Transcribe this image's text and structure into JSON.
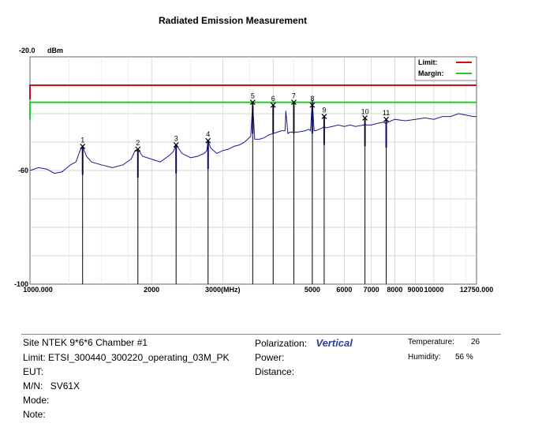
{
  "chart_data": {
    "type": "line",
    "title": "Radiated Emission Measurement",
    "ylabel": "dBm",
    "y_top_label": "-20.0",
    "y_ticks": [
      -60,
      -100
    ],
    "ylim": [
      -100,
      -20
    ],
    "x_ticks": [
      {
        "value": 1000,
        "label": "1000.000"
      },
      {
        "value": 2000,
        "label": "2000"
      },
      {
        "value": 3000,
        "label": "3000(MHz)"
      },
      {
        "value": 5000,
        "label": "5000"
      },
      {
        "value": 6000,
        "label": "6000"
      },
      {
        "value": 7000,
        "label": "7000"
      },
      {
        "value": 8000,
        "label": "8000"
      },
      {
        "value": 9000,
        "label": "9000"
      },
      {
        "value": 10000,
        "label": "10000"
      },
      {
        "value": 12750,
        "label": "12750.000"
      }
    ],
    "xlim": [
      1000,
      12750
    ],
    "x_scale": "log",
    "limit": {
      "label": "Limit:",
      "value": -30,
      "color": "#cc1111"
    },
    "margin": {
      "label": "Margin:",
      "value": -36,
      "color": "#22cc22"
    },
    "trace_color": "#1a1a8c",
    "trace": {
      "x": [
        1000,
        1050,
        1100,
        1150,
        1200,
        1260,
        1300,
        1330,
        1350,
        1380,
        1420,
        1500,
        1600,
        1700,
        1780,
        1820,
        1850,
        1900,
        2000,
        2100,
        2200,
        2260,
        2300,
        2380,
        2500,
        2600,
        2700,
        2740,
        2760,
        2800,
        2900,
        3000,
        3100,
        3150,
        3200,
        3300,
        3400,
        3520,
        3560,
        3600,
        3700,
        3800,
        3900,
        4000,
        4100,
        4200,
        4280,
        4300,
        4350,
        4400,
        4600,
        4800,
        4900,
        4950,
        5000,
        5050,
        5100,
        5200,
        5300,
        5350,
        5400,
        5600,
        5800,
        6000,
        6200,
        6400,
        6700,
        6750,
        6800,
        7000,
        7200,
        7500,
        7620,
        7700,
        8000,
        8500,
        9000,
        9500,
        10000,
        10500,
        11000,
        11500,
        12000,
        12500,
        12750
      ],
      "y": [
        -60,
        -59,
        -59.5,
        -61,
        -60.5,
        -58,
        -57,
        -53,
        -51.5,
        -55,
        -57,
        -58,
        -59,
        -58,
        -56,
        -53,
        -52.5,
        -55,
        -56,
        -57,
        -55,
        -53.5,
        -51,
        -54,
        -55.5,
        -55,
        -54,
        -53,
        -49.5,
        -52,
        -54,
        -53,
        -52.5,
        -52,
        -51.5,
        -51,
        -50,
        -48,
        -36,
        -49,
        -49,
        -48.5,
        -47.5,
        -47,
        -46.5,
        -46,
        -46,
        -39,
        -47,
        -46.5,
        -46.5,
        -46,
        -45.5,
        -46,
        -35,
        -46,
        -46,
        -45.5,
        -45,
        -44.5,
        -45,
        -44.5,
        -44,
        -44.5,
        -44,
        -44.5,
        -44,
        -43.5,
        -44,
        -44,
        -43.5,
        -43,
        -43.5,
        -43,
        -42,
        -42.5,
        -42,
        -41.5,
        -42,
        -41,
        -41,
        -40,
        -40.5,
        -41,
        -41
      ]
    },
    "peaks": [
      {
        "label": "1",
        "x": 1350,
        "y": -51.5
      },
      {
        "label": "2",
        "x": 1850,
        "y": -52.5
      },
      {
        "label": "3",
        "x": 2300,
        "y": -51
      },
      {
        "label": "4",
        "x": 2760,
        "y": -49.5
      },
      {
        "label": "5",
        "x": 3560,
        "y": -36
      },
      {
        "label": "6",
        "x": 4000,
        "y": -37
      },
      {
        "label": "7",
        "x": 4500,
        "y": -36
      },
      {
        "label": "8",
        "x": 5000,
        "y": -37
      },
      {
        "label": "9",
        "x": 5350,
        "y": -41
      },
      {
        "label": "10",
        "x": 6750,
        "y": -41.5
      },
      {
        "label": "11",
        "x": 7620,
        "y": -42
      }
    ]
  },
  "info": {
    "site_label": "Site",
    "site_value": "NTEK 9*6*6 Chamber #1",
    "limit_label": "Limit:",
    "limit_value": "ETSI_300440_300220_operating_03M_PK",
    "eut_label": "EUT:",
    "mn_label": "M/N:",
    "mn_value": "SV61X",
    "mode_label": "Mode:",
    "note_label": "Note:",
    "polarization_label": "Polarization:",
    "polarization_value": "Vertical",
    "power_label": "Power:",
    "distance_label": "Distance:",
    "temperature_label": "Temperature:",
    "temperature_value": "26",
    "humidity_label": "Humidity:",
    "humidity_value": "56 %"
  }
}
